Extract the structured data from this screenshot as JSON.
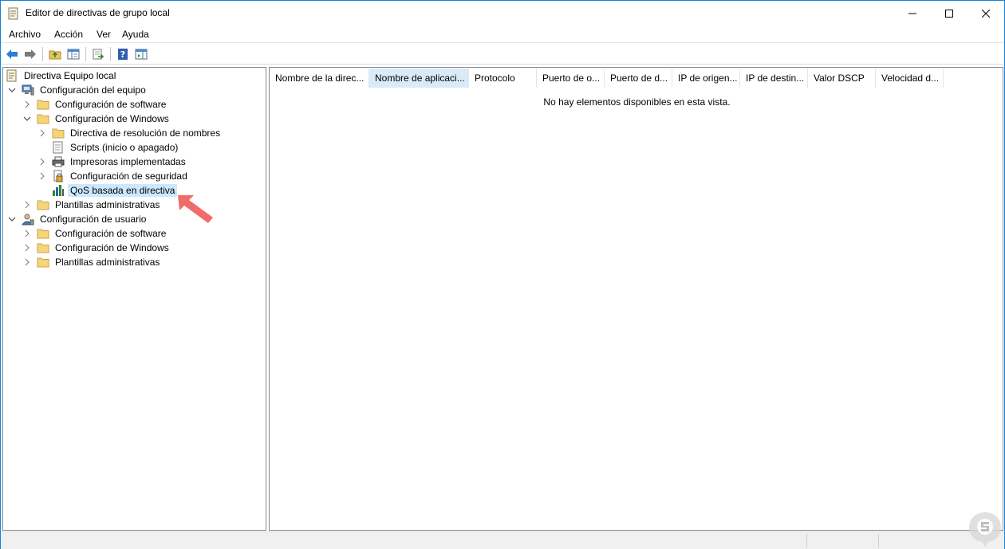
{
  "window": {
    "title": "Editor de directivas de grupo local"
  },
  "menu": {
    "items": [
      "Archivo",
      "Acción",
      "Ver",
      "Ayuda"
    ]
  },
  "toolbar": {
    "buttons": [
      "back-icon",
      "forward-icon",
      "up-folder-icon",
      "show-hide-tree-icon",
      "export-list-icon",
      "help-icon",
      "properties-view-icon"
    ]
  },
  "tree": {
    "root": "Directiva Equipo local",
    "computer_config": "Configuración del equipo",
    "cc_software": "Configuración de software",
    "cc_windows": "Configuración de Windows",
    "name_resolution": "Directiva de resolución de nombres",
    "scripts": "Scripts (inicio o apagado)",
    "printers": "Impresoras implementadas",
    "security": "Configuración de seguridad",
    "qos": "QoS basada en directiva",
    "cc_admin_templates": "Plantillas administrativas",
    "user_config": "Configuración de usuario",
    "uc_software": "Configuración de software",
    "uc_windows": "Configuración de Windows",
    "uc_admin_templates": "Plantillas administrativas"
  },
  "list": {
    "columns": [
      "Nombre de la direc...",
      "Nombre de aplicaci...",
      "Protocolo",
      "Puerto de o...",
      "Puerto de d...",
      "IP de origen...",
      "IP de destin...",
      "Valor DSCP",
      "Velocidad d..."
    ],
    "empty_message": "No hay elementos disponibles en esta vista."
  },
  "colors": {
    "selection": "#cce8ff",
    "header_highlight": "#d9ebf9",
    "annotation_arrow": "#f26b6b",
    "window_border": "#1883d7"
  }
}
